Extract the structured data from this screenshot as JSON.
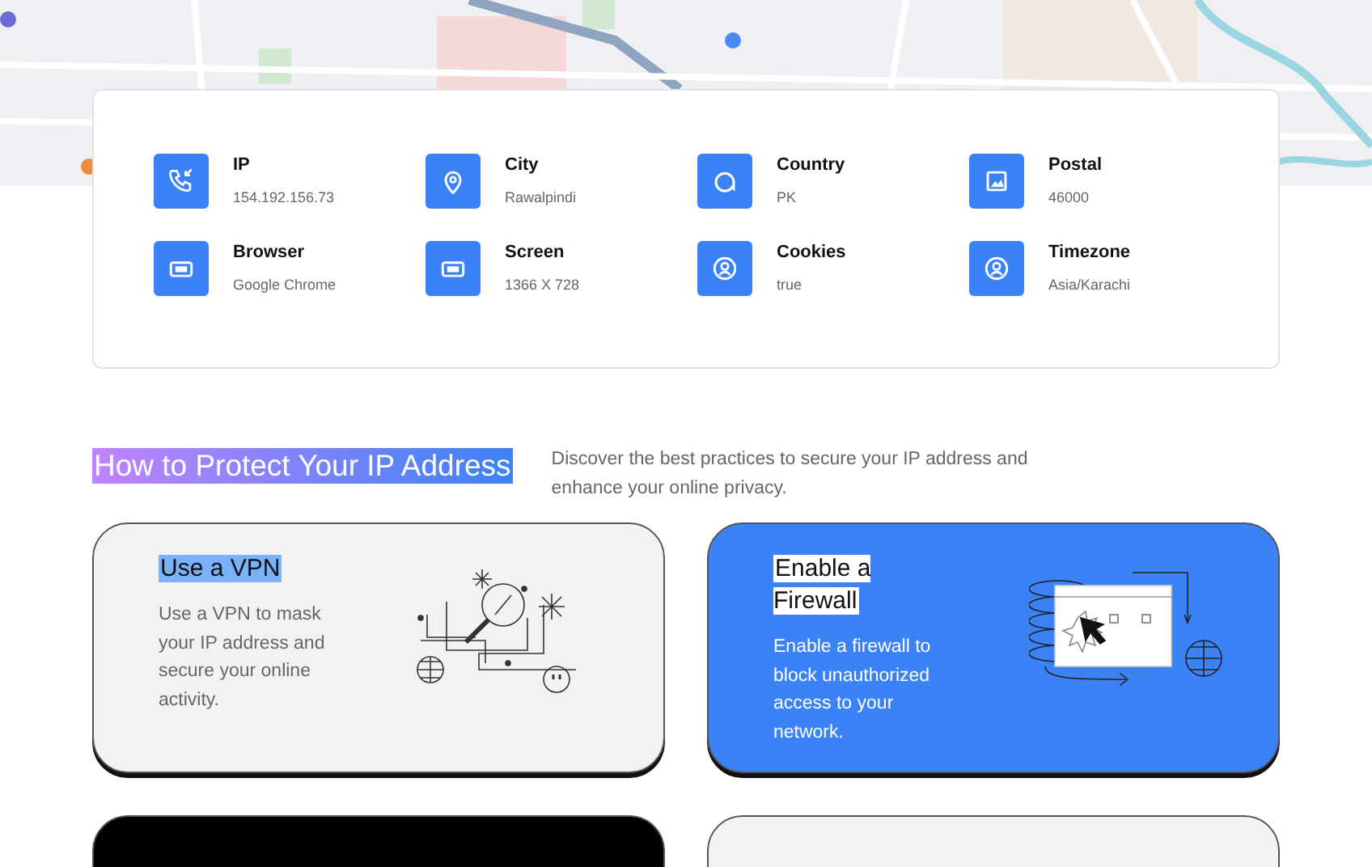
{
  "info": [
    {
      "label": "IP",
      "value": "154.192.156.73"
    },
    {
      "label": "City",
      "value": "Rawalpindi"
    },
    {
      "label": "Country",
      "value": "PK"
    },
    {
      "label": "Postal",
      "value": "46000"
    },
    {
      "label": "Browser",
      "value": "Google Chrome"
    },
    {
      "label": "Screen",
      "value": "1366 X 728"
    },
    {
      "label": "Cookies",
      "value": "true"
    },
    {
      "label": "Timezone",
      "value": "Asia/Karachi"
    }
  ],
  "section": {
    "title": "How to Protect Your IP Address",
    "description": "Discover the best practices to secure your IP address and enhance your online privacy."
  },
  "tips": [
    {
      "kind": "light",
      "title": "Use a VPN",
      "text": "Use a VPN to mask your IP address and secure your online activity."
    },
    {
      "kind": "blue",
      "title": "Enable a Firewall",
      "text": "Enable a firewall to block unauthorized access to your network."
    },
    {
      "kind": "dark"
    },
    {
      "kind": "light"
    }
  ]
}
